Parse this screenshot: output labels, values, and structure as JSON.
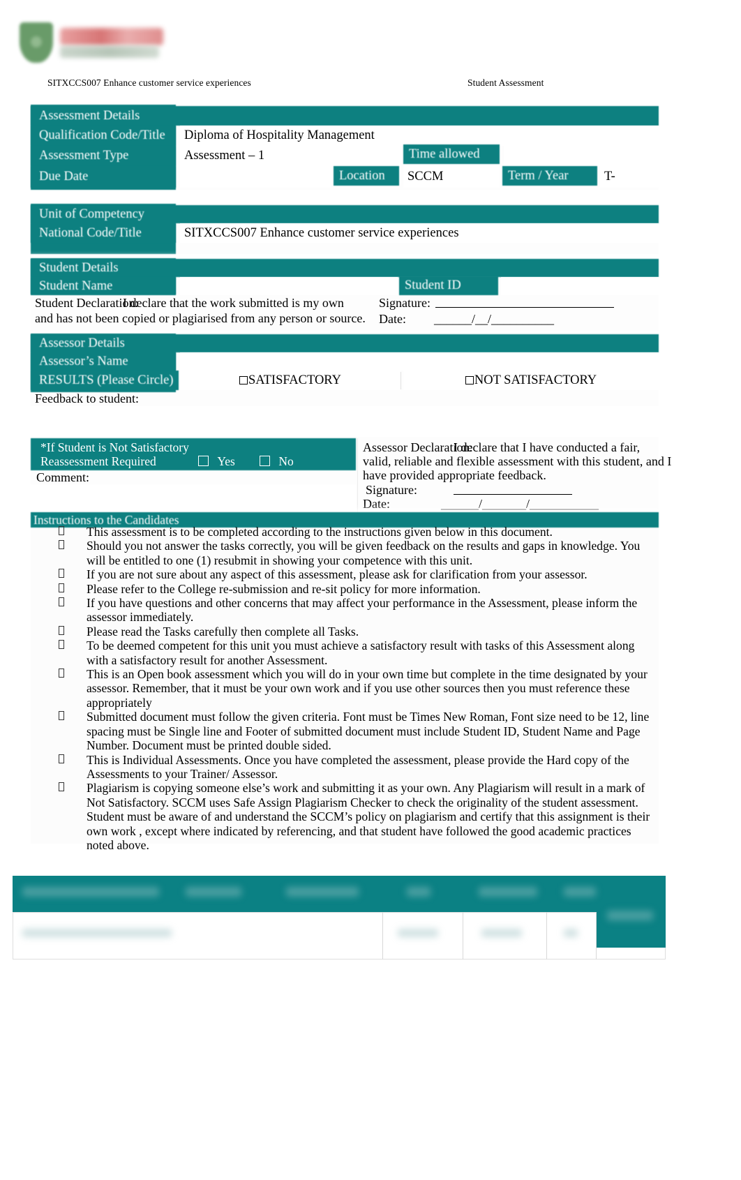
{
  "header": {
    "logo_alt": "college-logo",
    "running_head_left": "SITXCCS007 Enhance customer service experiences",
    "running_head_right": "Student Assessment"
  },
  "assessment_details": {
    "section_title": "Assessment Details",
    "qualification_label": "Qualification Code/Title",
    "qualification_value": "Diploma of Hospitality Management",
    "assessment_type_label": "Assessment Type",
    "assessment_type_value": "Assessment – 1",
    "time_allowed_label": "Time allowed",
    "time_allowed_value": "",
    "due_date_label": "Due Date",
    "due_date_value": "",
    "location_label": "Location",
    "location_value": "SCCM",
    "term_year_label": "Term / Year",
    "term_year_value": "T-"
  },
  "unit_of_competency": {
    "section_title": "Unit of Competency",
    "national_code_label": "National Code/Title",
    "national_code_value": "SITXCCS007 Enhance customer service experiences"
  },
  "student_details": {
    "section_title": "Student Details",
    "student_name_label": "Student Name",
    "student_name_value": "",
    "student_id_label": "Student ID",
    "student_id_value": "",
    "declaration_label": "Student Declaration:",
    "declaration_line1": "I declare that the work submitted is my own",
    "declaration_line2": "and has not been copied or plagiarised from any person or source.",
    "signature_label": "Signature:",
    "date_label": "Date:",
    "date_format": "______/__/__________"
  },
  "assessor_details": {
    "section_title": "Assessor Details",
    "assessor_name_label": "Assessor’s Name",
    "assessor_name_value": "",
    "results_label": "RESULTS (Please Circle)",
    "result_option_1": "SATISFACTORY",
    "result_option_2": "NOT SATISFACTORY",
    "feedback_label": "Feedback to student:",
    "feedback_value": ""
  },
  "reassessment": {
    "title": "*If Student is Not Satisfactory",
    "required_label": "Reassessment Required",
    "yes_label": "Yes",
    "no_label": "No",
    "comment_label": "Comment:",
    "comment_value": ""
  },
  "assessor_declaration": {
    "label": "Assessor Declaration:",
    "line1": "I declare that I have conducted a fair,",
    "line2": "valid, reliable and flexible assessment with this student, and I",
    "line3": "have provided appropriate feedback.",
    "signature_label": "Signature:",
    "date_label": "Date:",
    "date_format": "______/_______/___________"
  },
  "instructions": {
    "title": "Instructions to the Candidates",
    "bullet_glyph": "missing-glyph-box",
    "items": [
      "This assessment is to be completed according to the instructions given below in this document.",
      "Should you not answer the tasks correctly, you will be given feedback on the results and gaps in knowledge. You will be entitled to one (1) resubmit in showing your competence with this unit.",
      "If you are not sure about any aspect of this assessment, please ask for clarification from your assessor.",
      "Please refer to the College re-submission and re-sit policy for more information.",
      "If you have questions and other concerns that may affect your performance in the Assessment, please inform the assessor immediately.",
      "Please read the Tasks carefully then complete all Tasks.",
      "To be deemed competent for this unit you must achieve a satisfactory result with tasks of this Assessment along with a satisfactory result for another Assessment.",
      "This is an Open book assessment which you will do in your own time but complete in the time designated by your assessor. Remember, that it must be your own work and if you use other sources then you must reference these appropriately",
      "Submitted document must follow the given criteria. Font must be Times New Roman, Font size need to be 12, line spacing must be Single line and Footer of submitted document must include Student ID, Student Name and Page Number. Document must be printed double sided.",
      "This is Individual Assessments. Once you have completed the assessment, please provide the Hard copy of the Assessments to your Trainer/ Assessor.",
      "Plagiarism is copying someone else’s work and submitting it as your own. Any Plagiarism will result in a mark of Not Satisfactory. SCCM uses Safe Assign Plagiarism Checker to check the originality of the student assessment. Student must be aware of and understand the SCCM’s policy on plagiarism and certify that this assignment is their own work , except where indicated by referencing, and that student have followed the good academic practices noted above."
    ]
  },
  "footer_table": {
    "note": "blurred/illegible footer table",
    "header_cells": [
      "",
      "",
      "",
      "",
      "",
      ""
    ],
    "body_cells": [
      "",
      "",
      "",
      ""
    ],
    "tab_label": ""
  },
  "colors": {
    "teal": "#0d8080",
    "teal_dark": "#0b8184",
    "text": "#000000",
    "white": "#ffffff"
  }
}
